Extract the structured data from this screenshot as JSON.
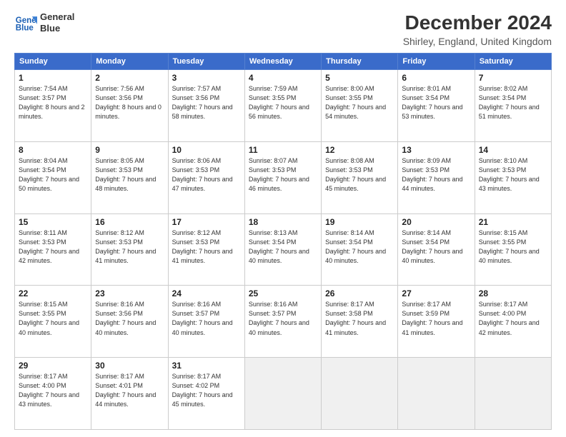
{
  "logo": {
    "line1": "General",
    "line2": "Blue"
  },
  "title": "December 2024",
  "subtitle": "Shirley, England, United Kingdom",
  "days_header": [
    "Sunday",
    "Monday",
    "Tuesday",
    "Wednesday",
    "Thursday",
    "Friday",
    "Saturday"
  ],
  "weeks": [
    [
      {
        "day": "1",
        "sunrise": "7:54 AM",
        "sunset": "3:57 PM",
        "daylight": "8 hours and 2 minutes."
      },
      {
        "day": "2",
        "sunrise": "7:56 AM",
        "sunset": "3:56 PM",
        "daylight": "8 hours and 0 minutes."
      },
      {
        "day": "3",
        "sunrise": "7:57 AM",
        "sunset": "3:56 PM",
        "daylight": "7 hours and 58 minutes."
      },
      {
        "day": "4",
        "sunrise": "7:59 AM",
        "sunset": "3:55 PM",
        "daylight": "7 hours and 56 minutes."
      },
      {
        "day": "5",
        "sunrise": "8:00 AM",
        "sunset": "3:55 PM",
        "daylight": "7 hours and 54 minutes."
      },
      {
        "day": "6",
        "sunrise": "8:01 AM",
        "sunset": "3:54 PM",
        "daylight": "7 hours and 53 minutes."
      },
      {
        "day": "7",
        "sunrise": "8:02 AM",
        "sunset": "3:54 PM",
        "daylight": "7 hours and 51 minutes."
      }
    ],
    [
      {
        "day": "8",
        "sunrise": "8:04 AM",
        "sunset": "3:54 PM",
        "daylight": "7 hours and 50 minutes."
      },
      {
        "day": "9",
        "sunrise": "8:05 AM",
        "sunset": "3:53 PM",
        "daylight": "7 hours and 48 minutes."
      },
      {
        "day": "10",
        "sunrise": "8:06 AM",
        "sunset": "3:53 PM",
        "daylight": "7 hours and 47 minutes."
      },
      {
        "day": "11",
        "sunrise": "8:07 AM",
        "sunset": "3:53 PM",
        "daylight": "7 hours and 46 minutes."
      },
      {
        "day": "12",
        "sunrise": "8:08 AM",
        "sunset": "3:53 PM",
        "daylight": "7 hours and 45 minutes."
      },
      {
        "day": "13",
        "sunrise": "8:09 AM",
        "sunset": "3:53 PM",
        "daylight": "7 hours and 44 minutes."
      },
      {
        "day": "14",
        "sunrise": "8:10 AM",
        "sunset": "3:53 PM",
        "daylight": "7 hours and 43 minutes."
      }
    ],
    [
      {
        "day": "15",
        "sunrise": "8:11 AM",
        "sunset": "3:53 PM",
        "daylight": "7 hours and 42 minutes."
      },
      {
        "day": "16",
        "sunrise": "8:12 AM",
        "sunset": "3:53 PM",
        "daylight": "7 hours and 41 minutes."
      },
      {
        "day": "17",
        "sunrise": "8:12 AM",
        "sunset": "3:53 PM",
        "daylight": "7 hours and 41 minutes."
      },
      {
        "day": "18",
        "sunrise": "8:13 AM",
        "sunset": "3:54 PM",
        "daylight": "7 hours and 40 minutes."
      },
      {
        "day": "19",
        "sunrise": "8:14 AM",
        "sunset": "3:54 PM",
        "daylight": "7 hours and 40 minutes."
      },
      {
        "day": "20",
        "sunrise": "8:14 AM",
        "sunset": "3:54 PM",
        "daylight": "7 hours and 40 minutes."
      },
      {
        "day": "21",
        "sunrise": "8:15 AM",
        "sunset": "3:55 PM",
        "daylight": "7 hours and 40 minutes."
      }
    ],
    [
      {
        "day": "22",
        "sunrise": "8:15 AM",
        "sunset": "3:55 PM",
        "daylight": "7 hours and 40 minutes."
      },
      {
        "day": "23",
        "sunrise": "8:16 AM",
        "sunset": "3:56 PM",
        "daylight": "7 hours and 40 minutes."
      },
      {
        "day": "24",
        "sunrise": "8:16 AM",
        "sunset": "3:57 PM",
        "daylight": "7 hours and 40 minutes."
      },
      {
        "day": "25",
        "sunrise": "8:16 AM",
        "sunset": "3:57 PM",
        "daylight": "7 hours and 40 minutes."
      },
      {
        "day": "26",
        "sunrise": "8:17 AM",
        "sunset": "3:58 PM",
        "daylight": "7 hours and 41 minutes."
      },
      {
        "day": "27",
        "sunrise": "8:17 AM",
        "sunset": "3:59 PM",
        "daylight": "7 hours and 41 minutes."
      },
      {
        "day": "28",
        "sunrise": "8:17 AM",
        "sunset": "4:00 PM",
        "daylight": "7 hours and 42 minutes."
      }
    ],
    [
      {
        "day": "29",
        "sunrise": "8:17 AM",
        "sunset": "4:00 PM",
        "daylight": "7 hours and 43 minutes."
      },
      {
        "day": "30",
        "sunrise": "8:17 AM",
        "sunset": "4:01 PM",
        "daylight": "7 hours and 44 minutes."
      },
      {
        "day": "31",
        "sunrise": "8:17 AM",
        "sunset": "4:02 PM",
        "daylight": "7 hours and 45 minutes."
      },
      null,
      null,
      null,
      null
    ]
  ]
}
